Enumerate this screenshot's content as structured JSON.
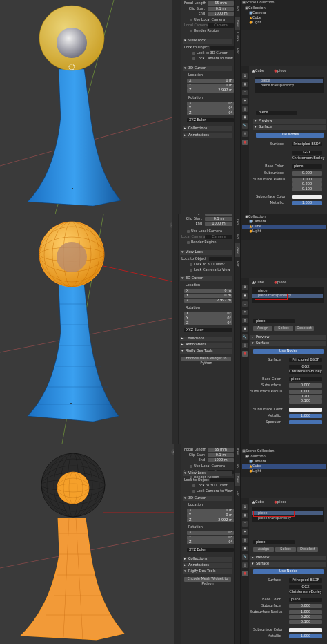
{
  "colors": {
    "accent": "#4772b3",
    "selection_orange": "#ff9a1f",
    "pedestal_blue": "#1f7fd6",
    "sphere_yellow": "#e8c62c",
    "annotation_red": "#d01818"
  },
  "npanel": {
    "focal_length_label": "Focal Length",
    "focal_length": "65 mm",
    "clip_start_label": "Clip Start",
    "clip_start": "0.1 m",
    "clip_end_label": "End",
    "clip_end": "1000 m",
    "use_local_camera": "Use Local Camera",
    "local_camera_label": "Local Camera",
    "local_camera": "Camera",
    "render_region": "Render Region",
    "view_lock": "View Lock",
    "lock_to_object": "Lock to Object",
    "lock_to_3d_cursor": "Lock to 3D Cursor",
    "lock_camera_to_view": "Lock Camera to View",
    "cursor_3d": "3D Cursor",
    "location": "Location",
    "x": "X",
    "y": "Y",
    "z": "Z",
    "loc_x": "0 m",
    "loc_y": "0 m",
    "loc_z": "2.992 m",
    "rotation": "Rotation",
    "rot_x": "0°",
    "rot_y": "0°",
    "rot_z": "0°",
    "rot_mode": "XYZ Euler",
    "collections": "Collections",
    "annotations": "Annotations",
    "rigify_dev_tools": "Rigify Dev Tools",
    "encode_mesh": "Encode Mesh Widget to Python"
  },
  "tabs": {
    "tool": "Tool",
    "view": "View",
    "create": "Create",
    "edit": "Edit",
    "item": "Item"
  },
  "outliner": {
    "scene_collection": "Scene Collection",
    "collection": "Collection",
    "camera": "Camera",
    "cube": "Cube",
    "light": "Light"
  },
  "material": {
    "object_name": "Cube",
    "material_name": "piece",
    "slot1": "piece",
    "slot2": "piece transparency",
    "assign": "Assign",
    "select": "Select",
    "deselect": "Deselect",
    "preview": "Preview",
    "surface": "Surface",
    "use_nodes": "Use Nodes",
    "surface_label": "Surface",
    "surface_value": "Principled BSDF",
    "distribution": "GGX",
    "subsurface_method": "Christensen-Burley",
    "base_color_label": "Base Color",
    "base_color_value": "piece",
    "subsurface_label": "Subsurface",
    "subsurface_value": "0.000",
    "subsurface_radius_label": "Subsurface Radius",
    "radius_1": "1.000",
    "radius_2": "0.200",
    "radius_3": "0.100",
    "subsurface_color_label": "Subsurface Color",
    "metallic_label": "Metallic",
    "metallic_value": "1.000",
    "specular_label": "Specular"
  }
}
